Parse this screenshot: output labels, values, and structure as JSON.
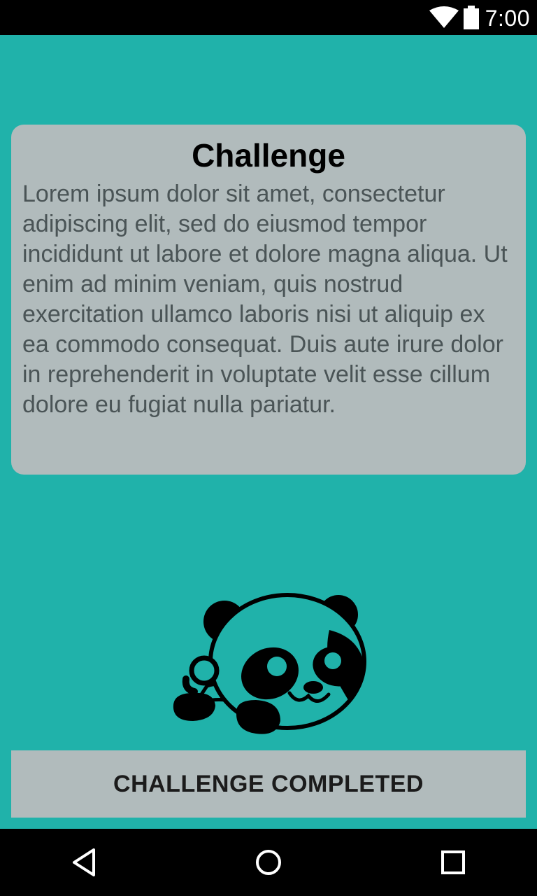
{
  "status_bar": {
    "time": "7:00",
    "icons": [
      "wifi-icon",
      "battery-icon"
    ]
  },
  "card": {
    "title": "Challenge",
    "body": "Lorem ipsum dolor sit amet, consectetur adipiscing elit, sed do eiusmod tempor incididunt ut labore et dolore magna aliqua. Ut enim ad minim veniam, quis nostrud exercitation ullamco laboris nisi ut aliquip ex ea commodo consequat. Duis aute irure dolor in reprehenderit in voluptate velit esse cillum dolore eu fugiat nulla pariatur."
  },
  "illustration": {
    "icon": "panda-icon"
  },
  "button": {
    "label": "CHALLENGE COMPLETED"
  },
  "nav_bar": {
    "icons": [
      "back-icon",
      "home-icon",
      "recent-apps-icon"
    ]
  },
  "colors": {
    "background": "#20b2aa",
    "card": "#b1bbbc",
    "body_text": "#4a5456",
    "bars": "#000000"
  }
}
